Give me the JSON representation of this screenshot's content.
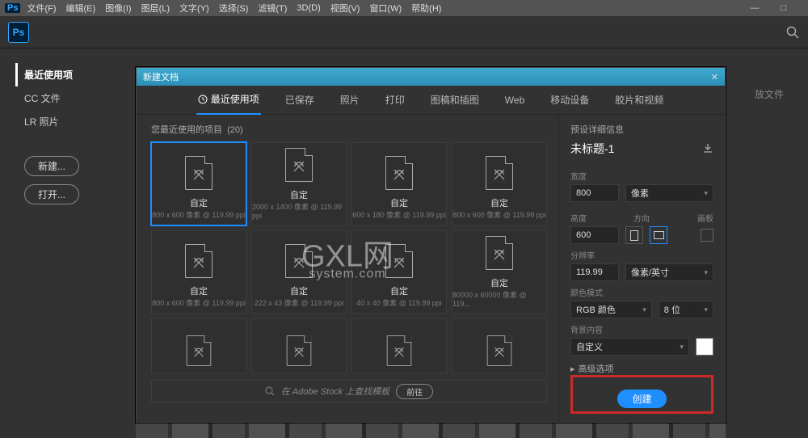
{
  "menubar": [
    "文件(F)",
    "编辑(E)",
    "图像(I)",
    "图层(L)",
    "文字(Y)",
    "选择(S)",
    "滤镜(T)",
    "3D(D)",
    "视图(V)",
    "窗口(W)",
    "帮助(H)"
  ],
  "drop_hint": "放文件",
  "start": {
    "items": [
      "最近使用项",
      "CC 文件",
      "LR 照片"
    ],
    "new_btn": "新建...",
    "open_btn": "打开..."
  },
  "dialog": {
    "title": "新建文档",
    "tabs": [
      "最近使用项",
      "已保存",
      "照片",
      "打印",
      "图稿和插图",
      "Web",
      "移动设备",
      "胶片和视频"
    ],
    "recent_label": "您最近使用的项目",
    "recent_count": "(20)",
    "presets": [
      {
        "title": "自定",
        "sub": "800 x 600 像素 @ 119.99 ppi"
      },
      {
        "title": "自定",
        "sub": "2000 x 1400 像素 @ 119.99 ppi"
      },
      {
        "title": "自定",
        "sub": "600 x 180 像素 @ 119.99 ppi"
      },
      {
        "title": "自定",
        "sub": "800 x 600 像素 @ 119.99 ppi"
      },
      {
        "title": "自定",
        "sub": "800 x 600 像素 @ 119.99 ppi"
      },
      {
        "title": "自定",
        "sub": "222 x 43 像素 @ 119.99 ppi"
      },
      {
        "title": "自定",
        "sub": "40 x 40 像素 @ 119.99 ppi"
      },
      {
        "title": "自定",
        "sub": "80000 x 60000 像素 @ 119..."
      }
    ],
    "stock_placeholder": "在 Adobe Stock 上查找模板",
    "go_btn": "前往"
  },
  "details": {
    "section": "预设详细信息",
    "name": "未标题-1",
    "width_label": "宽度",
    "width": "800",
    "width_unit": "像素",
    "height_label": "高度",
    "height": "600",
    "orient_label": "方向",
    "artboard_label": "画板",
    "res_label": "分辨率",
    "res": "119.99",
    "res_unit": "像素/英寸",
    "mode_label": "颜色模式",
    "mode": "RGB 颜色",
    "depth": "8 位",
    "bg_label": "背景内容",
    "bg": "自定义",
    "advanced": "高级选项",
    "create": "创建"
  },
  "watermark": {
    "main": "GXL网",
    "sub": "system.com"
  }
}
